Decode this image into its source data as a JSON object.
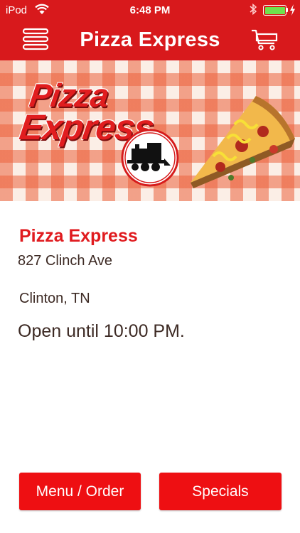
{
  "status_bar": {
    "carrier": "iPod",
    "time": "6:48 PM",
    "battery_color": "#6ee24c"
  },
  "nav": {
    "title": "Pizza Express",
    "menu_icon": "hamburger-menu-icon",
    "cart_icon": "shopping-cart-icon",
    "bar_color": "#d8191c"
  },
  "banner": {
    "logo_line1": "Pizza",
    "logo_line2": "Express",
    "badge_icon": "train-icon",
    "image": "pizza-slice-image"
  },
  "store": {
    "name": "Pizza Express",
    "address": "827 Clinch Ave",
    "city": "Clinton, TN",
    "hours": "Open until 10:00 PM."
  },
  "buttons": {
    "menu_order": "Menu / Order",
    "specials": "Specials",
    "color": "#ee0f12"
  }
}
